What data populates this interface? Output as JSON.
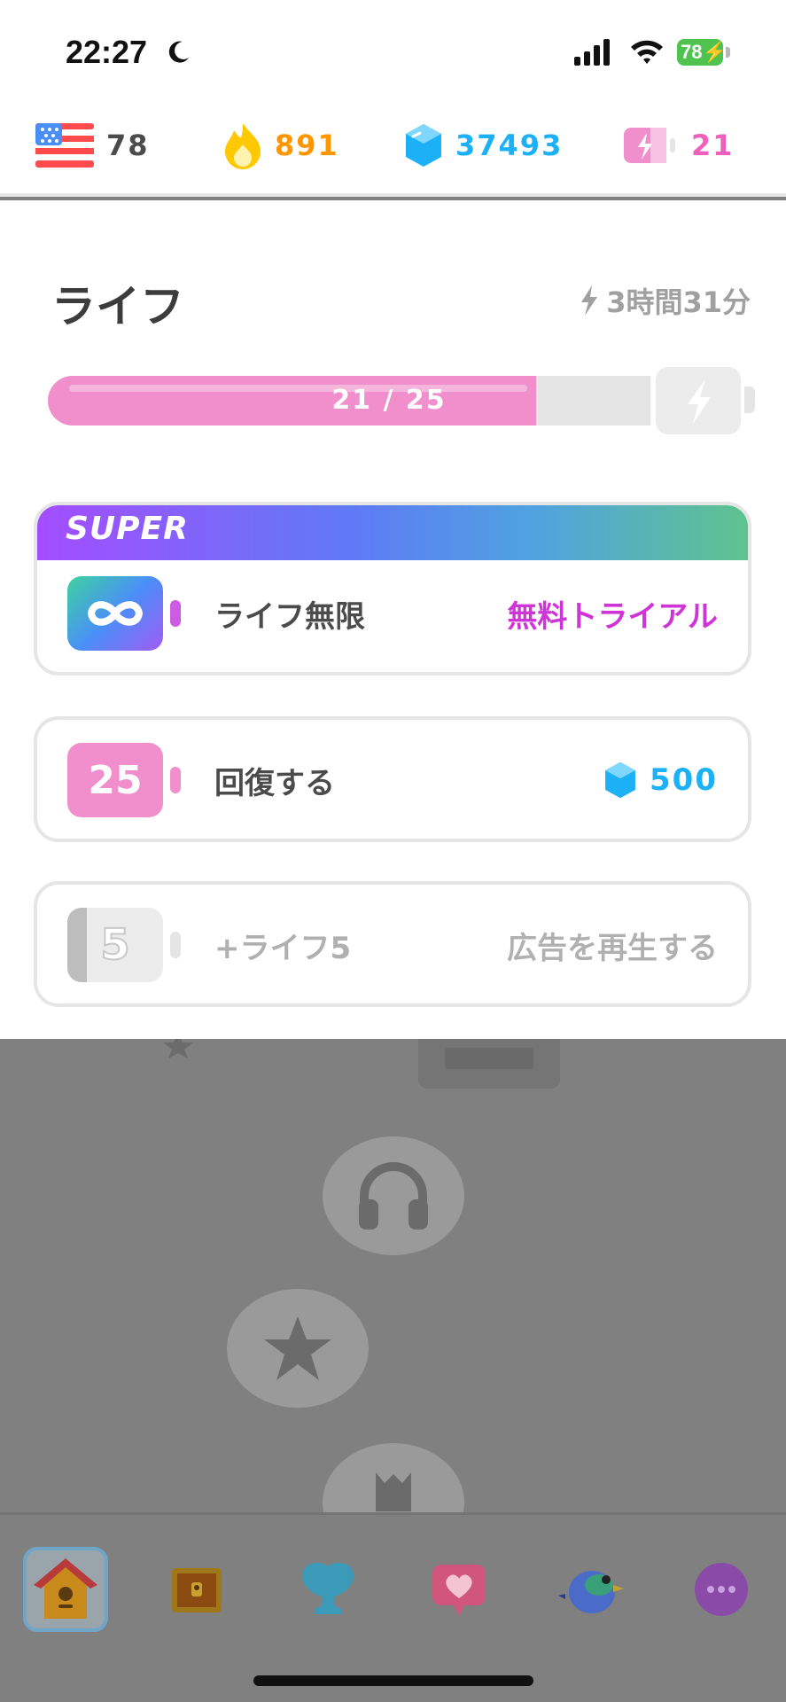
{
  "status_bar": {
    "time": "22:27",
    "battery": "78"
  },
  "stats": {
    "language_level": "78",
    "streak": "891",
    "gems": "37493",
    "energy": "21"
  },
  "energy_panel": {
    "title": "ライフ",
    "refill_timer": "3時間31分",
    "bar_text": "21 / 25",
    "current": 21,
    "max": 25
  },
  "super_card": {
    "header": "SUPER",
    "label": "ライフ無限",
    "action": "無料トライアル"
  },
  "refill_card": {
    "icon_number": "25",
    "label": "回復する",
    "price": "500"
  },
  "ad_card": {
    "icon_number": "5",
    "label": "+ライフ5",
    "action": "広告を再生する"
  },
  "nav": {
    "items": [
      "home-icon",
      "chest-icon",
      "shield-icon",
      "heart-message-icon",
      "bird-icon",
      "more-icon"
    ]
  },
  "colors": {
    "accent_pink": "#f08fcc",
    "trial_magenta": "#ce34d6",
    "gem_blue": "#1cb0f6",
    "streak_orange": "#ff9600"
  }
}
